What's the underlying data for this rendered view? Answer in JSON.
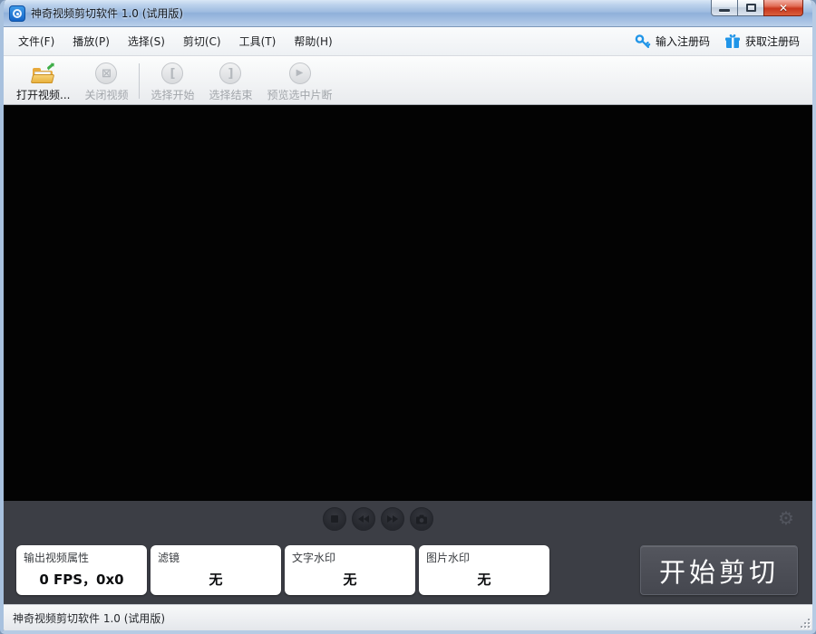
{
  "window": {
    "title": "神奇视频剪切软件 1.0 (试用版)"
  },
  "menu": {
    "items": [
      "文件(F)",
      "播放(P)",
      "选择(S)",
      "剪切(C)",
      "工具(T)",
      "帮助(H)"
    ],
    "enter_code_label": "输入注册码",
    "get_code_label": "获取注册码"
  },
  "toolbar": {
    "items": [
      {
        "label": "打开视频...",
        "icon": "open-folder",
        "enabled": true
      },
      {
        "label": "关闭视频",
        "icon": "close-circle",
        "enabled": false
      },
      {
        "label": "选择开始",
        "icon": "bracket-left-circle",
        "enabled": false,
        "glyph": "["
      },
      {
        "label": "选择结束",
        "icon": "bracket-right-circle",
        "enabled": false,
        "glyph": "]"
      },
      {
        "label": "预览选中片断",
        "icon": "preview-play-circle",
        "enabled": false,
        "glyph": "▶"
      }
    ]
  },
  "player": {
    "controls": [
      "stop",
      "rewind",
      "fast-forward",
      "snapshot"
    ],
    "settings_icon": "gear",
    "gear_glyph": "⚙"
  },
  "panels": [
    {
      "label": "输出视频属性",
      "value": "0 FPS，0x0"
    },
    {
      "label": "滤镜",
      "value": "无"
    },
    {
      "label": "文字水印",
      "value": "无"
    },
    {
      "label": "图片水印",
      "value": "无"
    }
  ],
  "start_button_label": "开始剪切",
  "statusbar": {
    "text": "神奇视频剪切软件 1.0 (试用版)"
  },
  "colors": {
    "titlebar_blue": "#9fbce0",
    "accent_blue": "#2095e8",
    "dark_panel": "#3c3e45",
    "close_red": "#c8361d",
    "video_black": "#030303"
  }
}
